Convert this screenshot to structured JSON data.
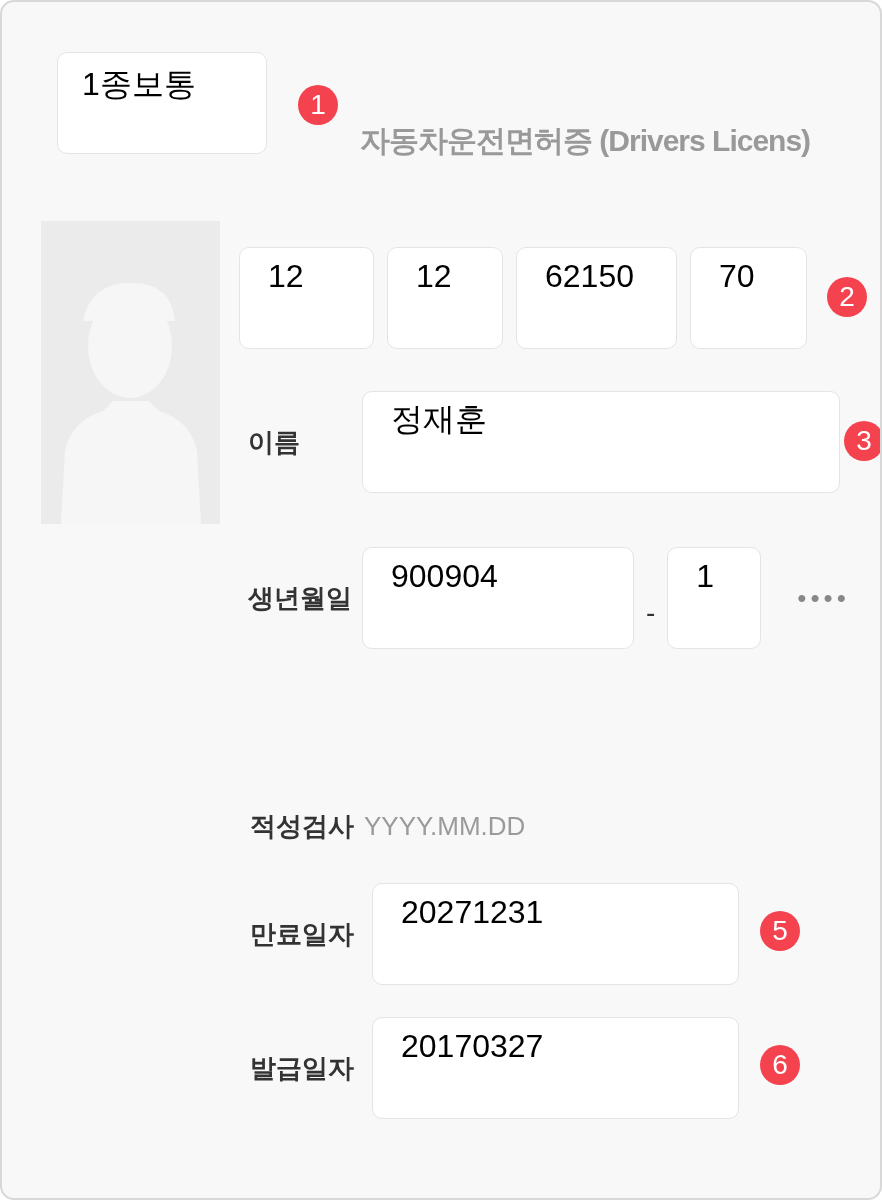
{
  "license_type": {
    "value": "1종보통",
    "badge": "1"
  },
  "title": "자동차운전면허증 (Drivers Licens)",
  "license_number": {
    "parts": [
      "12",
      "12",
      "62150",
      "70"
    ],
    "badge": "2"
  },
  "name": {
    "label": "이름",
    "value": "정재훈",
    "badge": "3"
  },
  "birth": {
    "label": "생년월일",
    "value": "900904",
    "separator": "-",
    "gender_digit": "1",
    "masked": "••••"
  },
  "aptitude_test": {
    "label": "적성검사",
    "placeholder": "YYYY.MM.DD"
  },
  "expiry_date": {
    "label": "만료일자",
    "value": "20271231",
    "badge": "5"
  },
  "issue_date": {
    "label": "발급일자",
    "value": "20170327",
    "badge": "6"
  }
}
